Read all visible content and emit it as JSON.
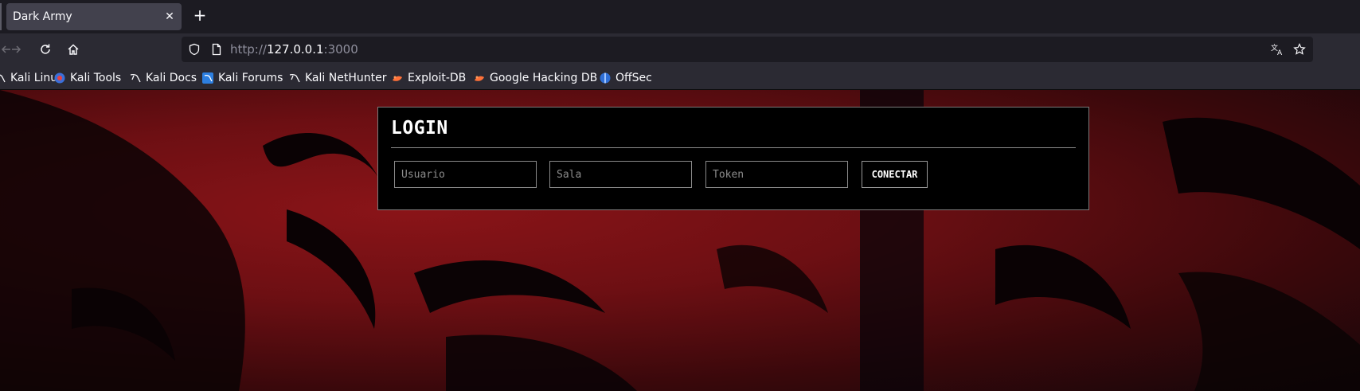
{
  "tab": {
    "title": "Dark Army",
    "close_glyph": "✕",
    "new_tab_glyph": "+"
  },
  "navbar": {
    "back_icon": "arrow-left-icon",
    "forward_icon": "arrow-right-icon",
    "reload_icon": "reload-icon",
    "home_icon": "home-icon",
    "url_scheme": "http://",
    "url_host": "127.0.0.1",
    "url_rest": ":3000",
    "translate_icon": "translate-icon",
    "bookmark_star_icon": "star-icon"
  },
  "bookmarks": [
    {
      "label": "Kali Linux",
      "icon": "kali-dragon-icon"
    },
    {
      "label": "Kali Tools",
      "icon": "kali-tools-icon"
    },
    {
      "label": "Kali Docs",
      "icon": "kali-dragon-icon"
    },
    {
      "label": "Kali Forums",
      "icon": "kali-forums-icon"
    },
    {
      "label": "Kali NetHunter",
      "icon": "kali-dragon-icon"
    },
    {
      "label": "Exploit-DB",
      "icon": "exploit-db-icon"
    },
    {
      "label": "Google Hacking DB",
      "icon": "exploit-db-icon"
    },
    {
      "label": "OffSec",
      "icon": "offsec-icon"
    }
  ],
  "login": {
    "title": "LOGIN",
    "user_placeholder": "Usuario",
    "room_placeholder": "Sala",
    "token_placeholder": "Token",
    "connect_label": "CONECTAR"
  },
  "colors": {
    "page_red": "#6d0f13",
    "panel_bg": "#000000",
    "chrome_bg": "#2b2a33"
  }
}
